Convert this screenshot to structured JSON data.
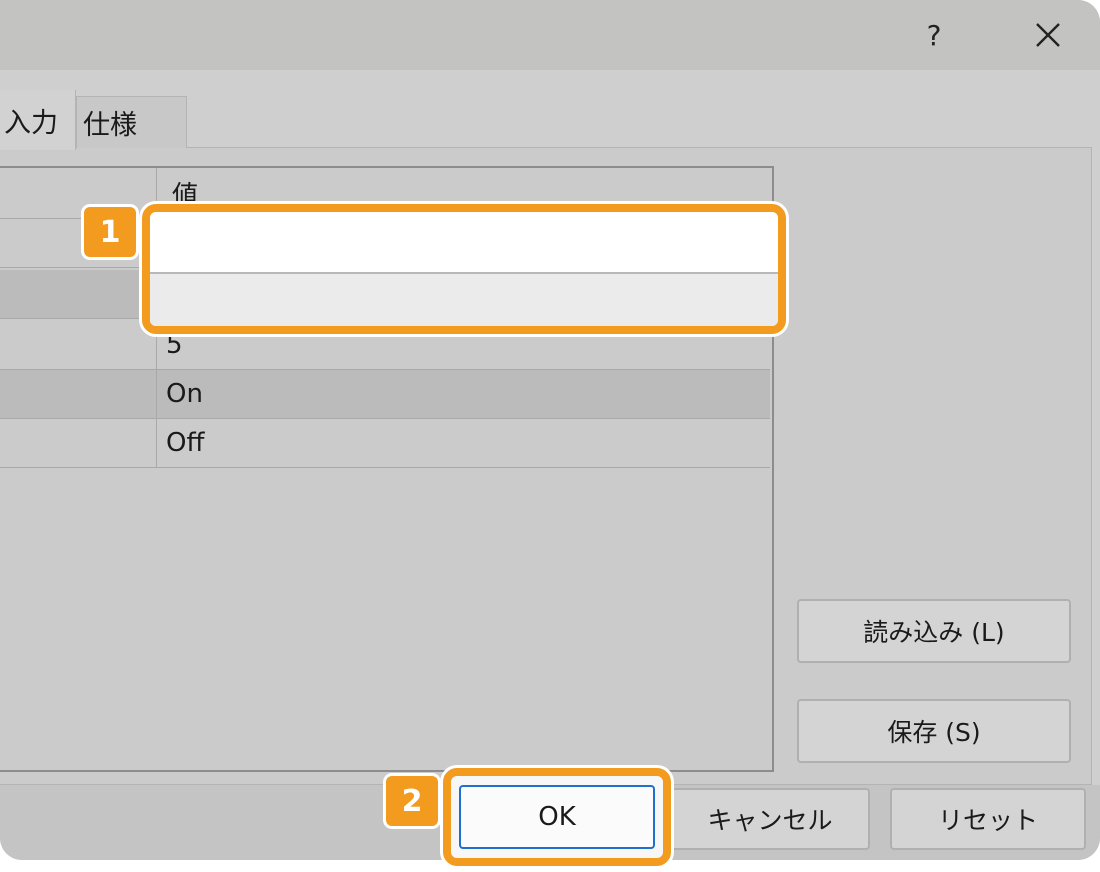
{
  "titlebar": {
    "help_label": "?",
    "close_icon": "close-icon"
  },
  "tabs": [
    {
      "label": "入力"
    },
    {
      "label": "仕様"
    }
  ],
  "grid": {
    "header_value": "値",
    "rows": [
      {
        "value": ""
      },
      {
        "value": ""
      },
      {
        "value": "5"
      },
      {
        "value": "On"
      },
      {
        "value": "Off"
      }
    ]
  },
  "side_buttons": {
    "load": "読み込み (L)",
    "save": "保存 (S)"
  },
  "bottom_buttons": {
    "ok": "OK",
    "cancel": "キャンセル",
    "reset": "リセット"
  },
  "annotations": {
    "badge_1": "1",
    "badge_2": "2",
    "highlight_color": "#f39b1f"
  }
}
